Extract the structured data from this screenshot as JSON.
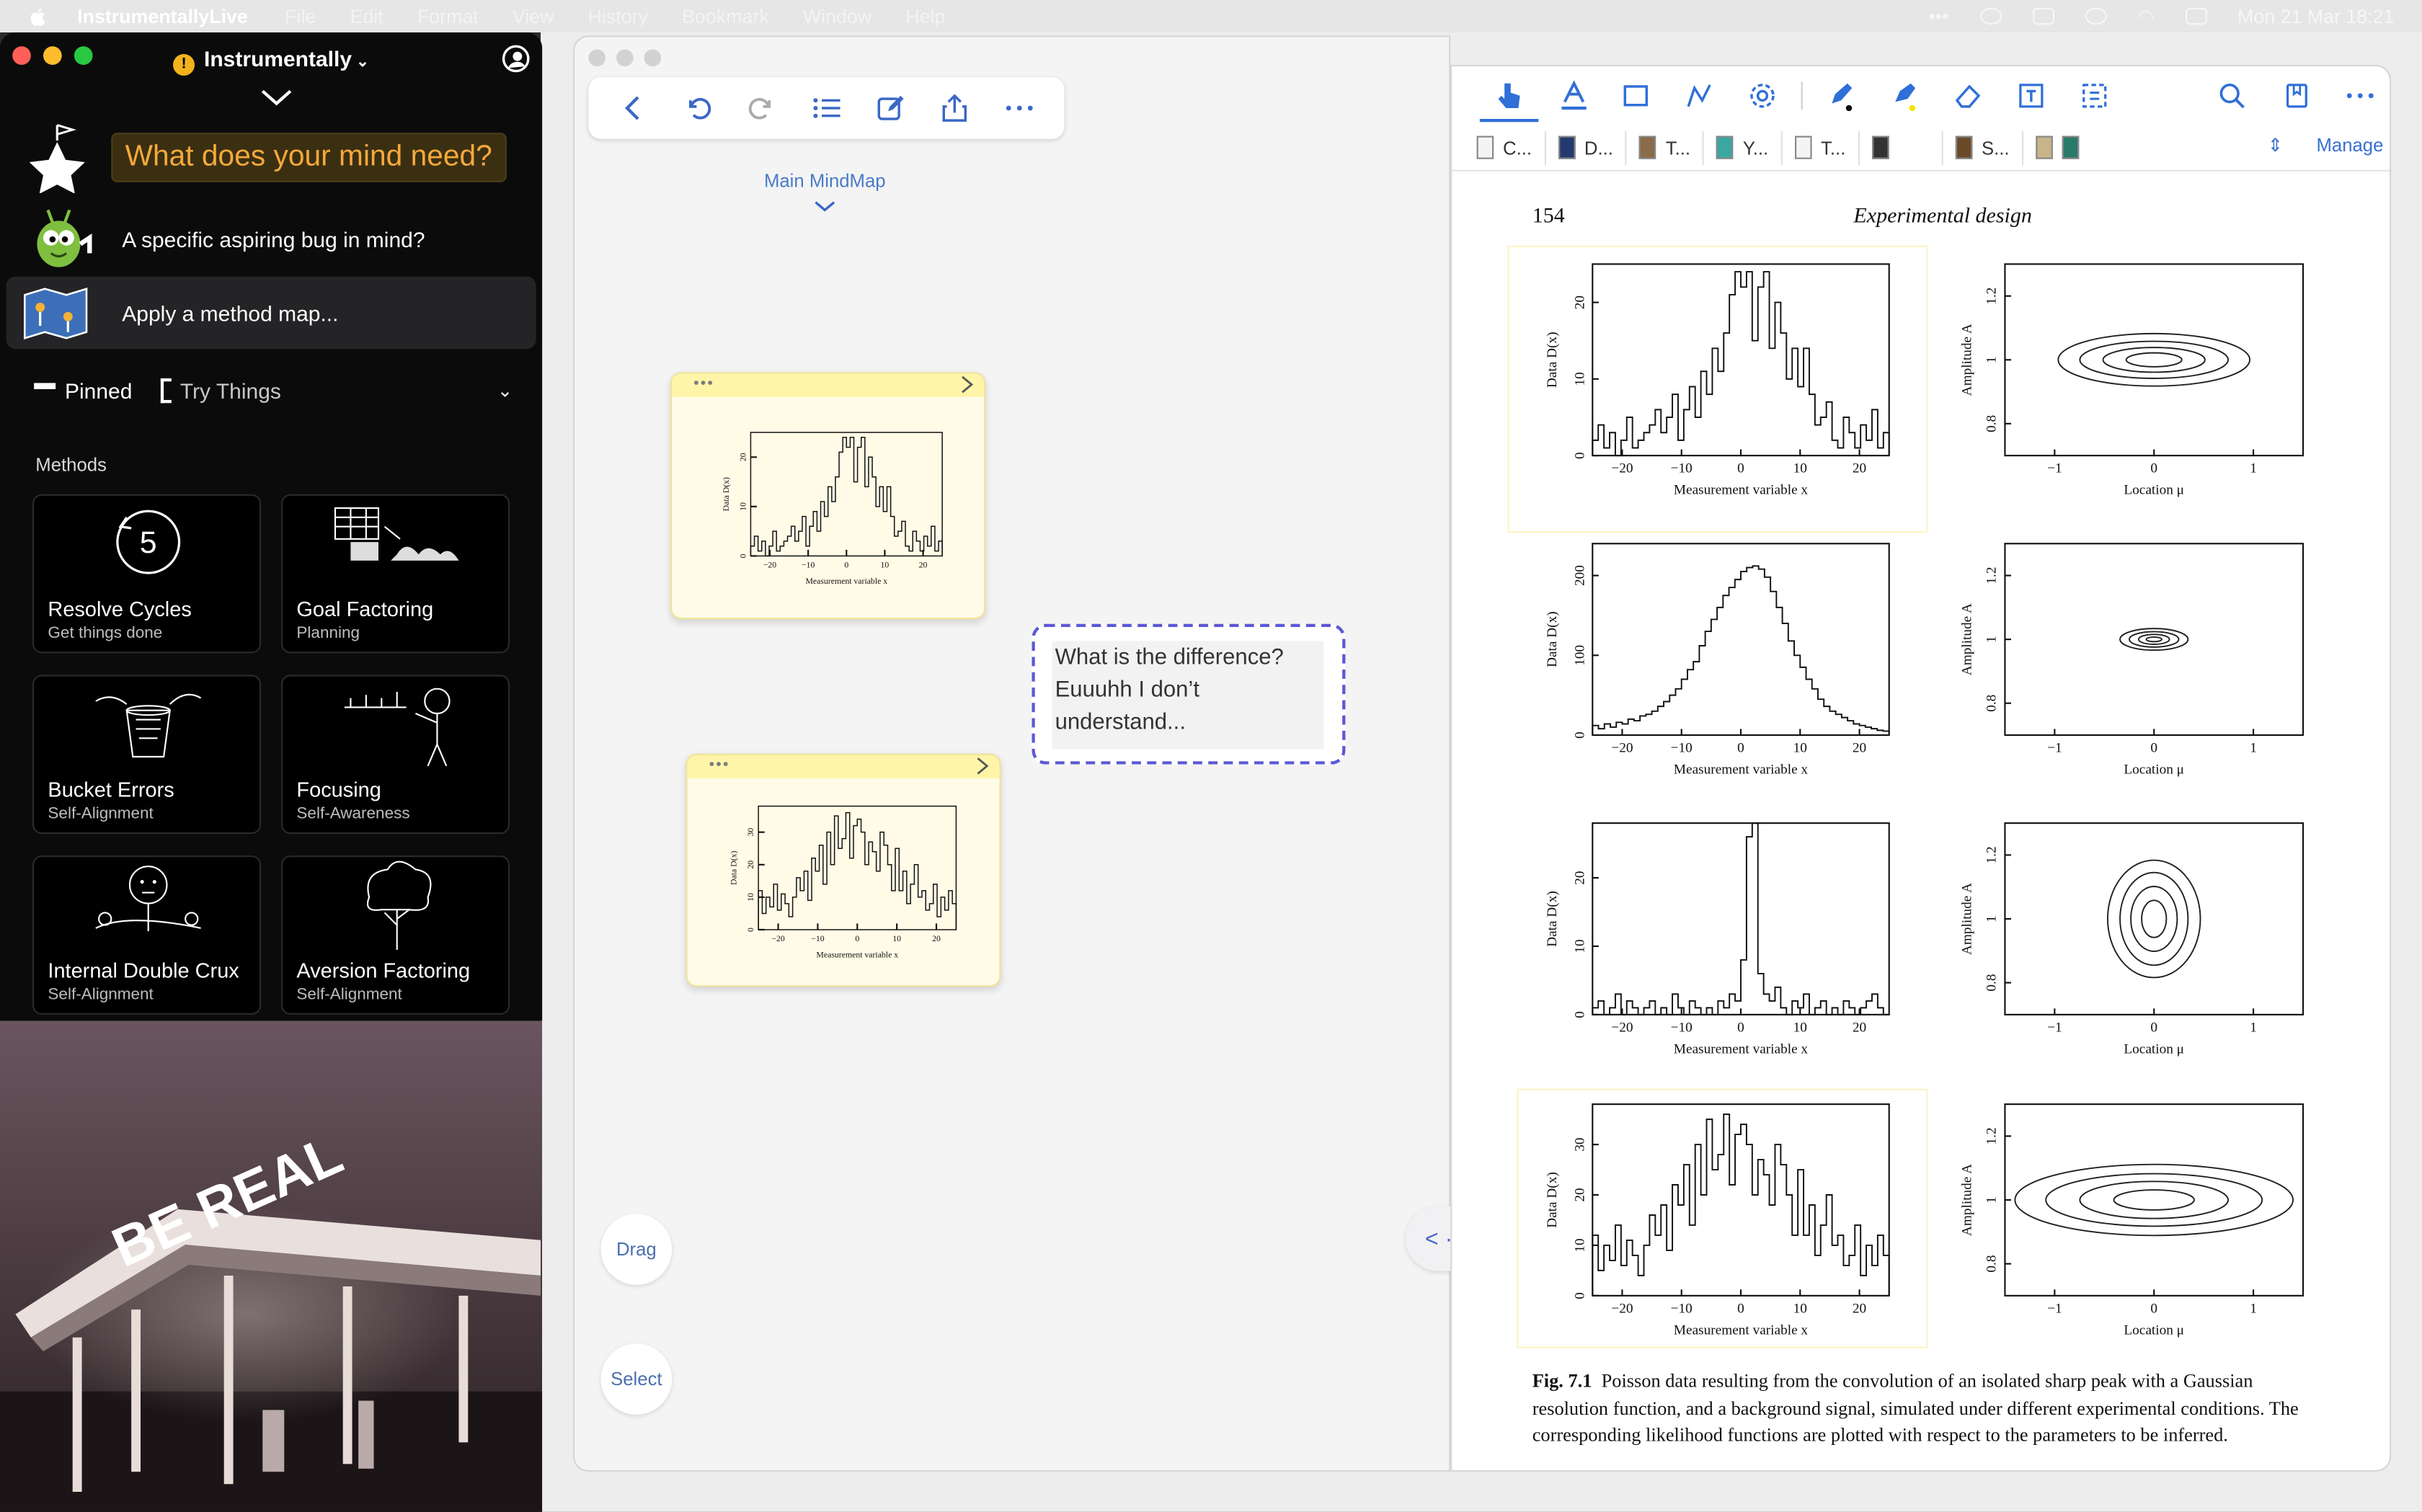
{
  "menubar": {
    "app_name": "InstrumentallyLive",
    "items": [
      "File",
      "Edit",
      "Format",
      "View",
      "History",
      "Bookmark",
      "Window",
      "Help"
    ],
    "datetime": "Mon 21 Mar  18:21"
  },
  "instrumentally": {
    "title": "Instrumentally",
    "mind_prompt": "What does your mind need?",
    "bug_prompt": "A specific aspiring bug in mind?",
    "apply_prompt": "Apply a method map...",
    "tab_pinned": "Pinned",
    "tab_try": "Try Things",
    "methods_label": "Methods",
    "methods": [
      {
        "title": "Resolve Cycles",
        "subtitle": "Get things done",
        "badge": "5"
      },
      {
        "title": "Goal Factoring",
        "subtitle": "Planning"
      },
      {
        "title": "Bucket Errors",
        "subtitle": "Self-Alignment"
      },
      {
        "title": "Focusing",
        "subtitle": "Self-Awareness"
      },
      {
        "title": "Internal Double Crux",
        "subtitle": "Self-Alignment"
      },
      {
        "title": "Aversion Factoring",
        "subtitle": "Self-Alignment"
      }
    ],
    "photo_sign": "BE REAL"
  },
  "mindmap": {
    "title": "Main MindMap",
    "note_dots": "•••",
    "question": "What is the difference? Euuuhh I don’t understand...",
    "drag_label": "Drag",
    "select_label": "Select",
    "splitter_label": "< · >"
  },
  "pdf": {
    "tabs": [
      "C...",
      "D...",
      "T...",
      "Y...",
      "T...",
      "",
      "S...",
      ""
    ],
    "manage_label": "Manage",
    "page_number": "154",
    "page_header": "Experimental design",
    "caption_label": "Fig. 7.1",
    "caption_text": "Poisson data resulting from the convolution of an isolated sharp peak with a Gaussian resolution function, and a background signal, simulated under different experimental conditions. The corresponding likelihood functions are plotted with respect to the parameters to be inferred.",
    "hist_ylabel": "Data   D(x)",
    "hist_xlabel": "Measurement variable   x",
    "contour_ylabel": "Amplitude   A",
    "contour_xlabel": "Location   μ",
    "hist_xticks": [
      "−20",
      "−10",
      "0",
      "10",
      "20"
    ],
    "contour_xticks": [
      "−1",
      "0",
      "1"
    ],
    "contour_yticks": [
      "0.8",
      "1",
      "1.2"
    ],
    "hist_yticks": [
      [
        "0",
        "10",
        "20"
      ],
      [
        "0",
        "100",
        "200"
      ],
      [
        "0",
        "10",
        "20"
      ],
      [
        "0",
        "10",
        "20",
        "30"
      ]
    ]
  },
  "chart_data": [
    {
      "type": "histogram",
      "series": [
        {
          "values": [
            2,
            4,
            1,
            3,
            0,
            2,
            5,
            1,
            2,
            3,
            4,
            6,
            3,
            5,
            8,
            2,
            6,
            9,
            5,
            11,
            8,
            14,
            11,
            16,
            21,
            24,
            22,
            24,
            15,
            22,
            24,
            14,
            20,
            16,
            10,
            14,
            9,
            14,
            8,
            4,
            5,
            7,
            2,
            1,
            5,
            3,
            1,
            4,
            2,
            6,
            1,
            3
          ]
        }
      ],
      "xlabel": "Measurement variable x",
      "ylabel": "Data D(x)",
      "xlim": [
        -25,
        25
      ],
      "ylim": [
        0,
        25
      ]
    },
    {
      "type": "contour",
      "xlabel": "Location μ",
      "ylabel": "Amplitude A",
      "xlim": [
        -1.5,
        1.5
      ],
      "ylim": [
        0.7,
        1.3
      ]
    },
    {
      "type": "histogram",
      "series": [
        {
          "values": [
            12,
            8,
            14,
            10,
            16,
            14,
            20,
            18,
            24,
            26,
            30,
            36,
            42,
            50,
            58,
            70,
            82,
            92,
            112,
            130,
            145,
            160,
            175,
            185,
            195,
            205,
            210,
            212,
            208,
            198,
            180,
            160,
            140,
            118,
            100,
            85,
            70,
            58,
            45,
            36,
            30,
            26,
            22,
            18,
            14,
            12,
            10,
            8,
            6,
            5
          ]
        }
      ],
      "xlabel": "Measurement variable x",
      "ylabel": "Data D(x)",
      "xlim": [
        -25,
        25
      ],
      "ylim": [
        0,
        240
      ]
    },
    {
      "type": "contour",
      "xlabel": "Location μ",
      "ylabel": "Amplitude A",
      "xlim": [
        -1.5,
        1.5
      ],
      "ylim": [
        0.7,
        1.3
      ]
    },
    {
      "type": "histogram",
      "series": [
        {
          "values": [
            1,
            2,
            0,
            1,
            3,
            0,
            2,
            1,
            0,
            1,
            2,
            0,
            1,
            0,
            3,
            1,
            0,
            2,
            1,
            0,
            1,
            0,
            2,
            1,
            3,
            2,
            8,
            26,
            28,
            6,
            3,
            2,
            4,
            1,
            0,
            2,
            1,
            3,
            0,
            1,
            2,
            0,
            1,
            0,
            2,
            1,
            0,
            1,
            2,
            3,
            1,
            0
          ]
        }
      ],
      "xlabel": "Measurement variable x",
      "ylabel": "Data D(x)",
      "xlim": [
        -25,
        25
      ],
      "ylim": [
        0,
        28
      ]
    },
    {
      "type": "contour",
      "xlabel": "Location μ",
      "ylabel": "Amplitude A",
      "xlim": [
        -1.5,
        1.5
      ],
      "ylim": [
        0.7,
        1.3
      ]
    },
    {
      "type": "histogram",
      "series": [
        {
          "values": [
            12,
            5,
            10,
            7,
            14,
            6,
            11,
            8,
            4,
            10,
            16,
            12,
            18,
            9,
            22,
            18,
            26,
            14,
            30,
            20,
            35,
            25,
            28,
            36,
            22,
            32,
            34,
            30,
            20,
            27,
            24,
            18,
            30,
            26,
            20,
            12,
            25,
            12,
            18,
            8,
            14,
            20,
            10,
            12,
            6,
            8,
            14,
            4,
            10,
            6,
            12,
            8
          ]
        }
      ],
      "xlabel": "Measurement variable x",
      "ylabel": "Data D(x)",
      "xlim": [
        -25,
        25
      ],
      "ylim": [
        0,
        38
      ]
    },
    {
      "type": "contour",
      "xlabel": "Location μ",
      "ylabel": "Amplitude A",
      "xlim": [
        -1.5,
        1.5
      ],
      "ylim": [
        0.7,
        1.3
      ]
    }
  ]
}
